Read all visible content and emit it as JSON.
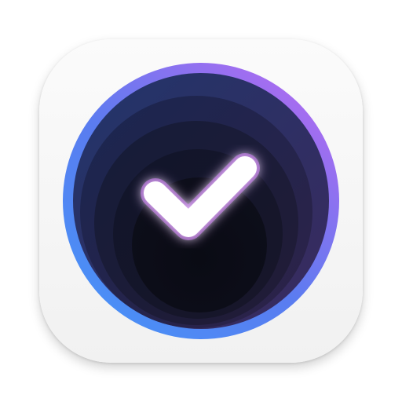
{
  "app_icon": {
    "name": "checkmark-app-icon",
    "colors": {
      "tile_background": "#f3f3f3",
      "ring_gradient_start": "#4f8ef7",
      "ring_gradient_end": "#a86bf0",
      "well_dark": "#0c0d16",
      "checkmark": "#ffffff",
      "checkmark_glow": "#c86cff"
    }
  }
}
